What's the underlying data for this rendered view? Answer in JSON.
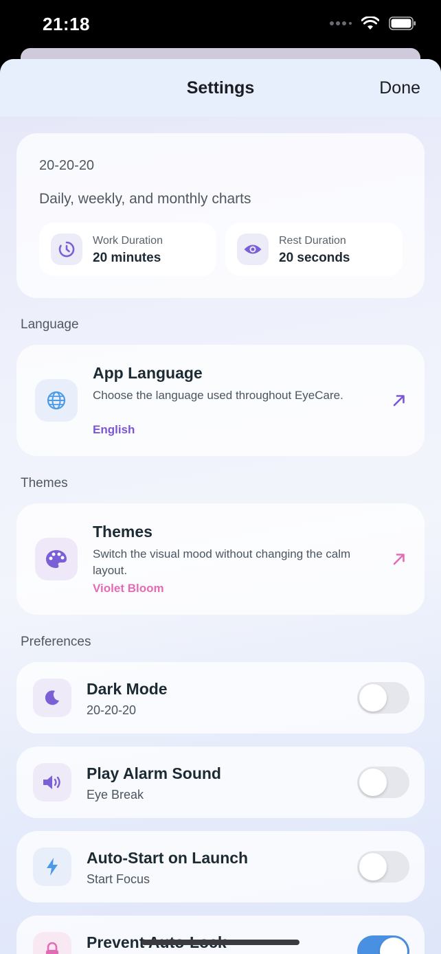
{
  "status_bar": {
    "time": "21:18"
  },
  "header": {
    "title": "Settings",
    "done_label": "Done"
  },
  "summary": {
    "label": "20-20-20",
    "description": "Daily, weekly, and monthly charts",
    "work": {
      "label": "Work Duration",
      "value": "20 minutes",
      "icon": "timer-icon"
    },
    "rest": {
      "label": "Rest Duration",
      "value": "20 seconds",
      "icon": "eye-icon"
    }
  },
  "sections": {
    "language": "Language",
    "themes": "Themes",
    "preferences": "Preferences"
  },
  "language_card": {
    "title": "App Language",
    "description": "Choose the language used throughout EyeCare.",
    "value": "English",
    "value_color": "#7a55d6",
    "icon": "globe-icon"
  },
  "theme_card": {
    "title": "Themes",
    "description": "Switch the visual mood without changing the calm layout.",
    "value": "Violet Bloom",
    "value_color": "#e36bb6",
    "icon": "palette-icon"
  },
  "preferences": [
    {
      "title": "Dark Mode",
      "subtitle": "20-20-20",
      "enabled": false,
      "icon": "moon-icon"
    },
    {
      "title": "Play Alarm Sound",
      "subtitle": "Eye Break",
      "enabled": false,
      "icon": "speaker-icon"
    },
    {
      "title": "Auto-Start on Launch",
      "subtitle": "Start Focus",
      "enabled": false,
      "icon": "bolt-icon"
    },
    {
      "title": "Prevent Auto-Lock",
      "subtitle": "",
      "enabled": true,
      "icon": "lock-icon"
    }
  ],
  "colors": {
    "accent_purple": "#7a55d6",
    "accent_pink": "#e36bb6",
    "accent_blue": "#4a90e2"
  }
}
